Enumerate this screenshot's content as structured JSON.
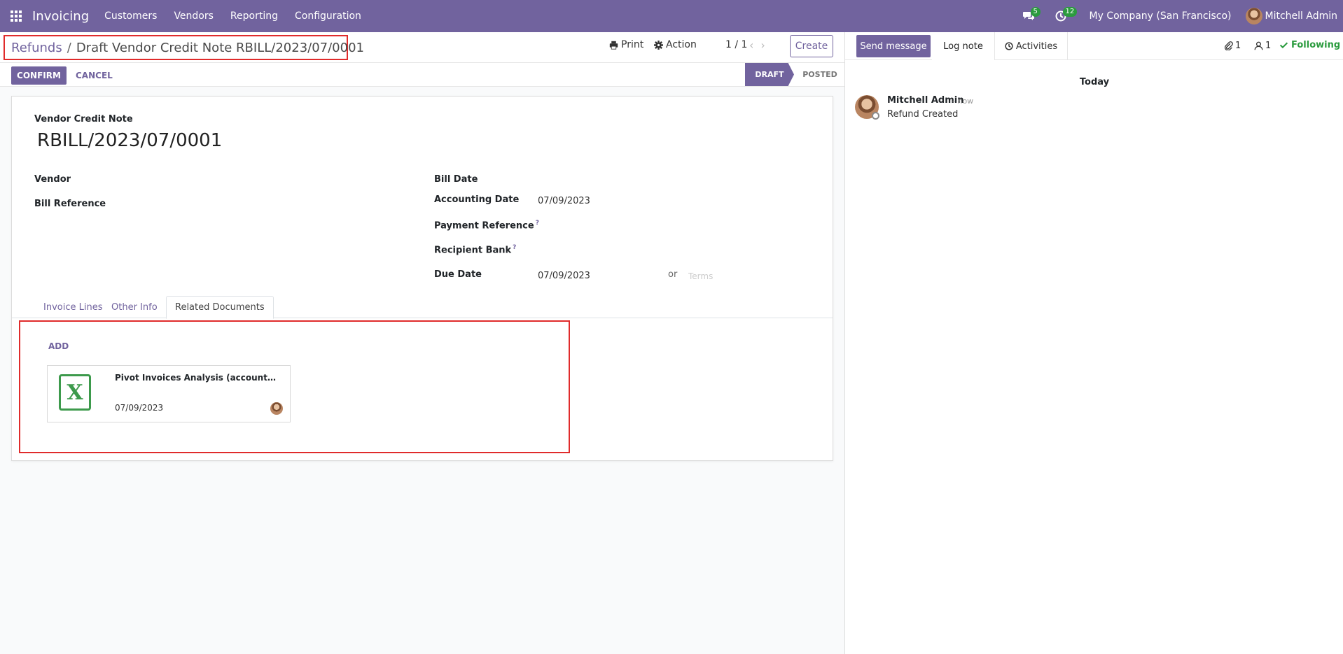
{
  "navbar": {
    "app_name": "Invoicing",
    "menu": [
      "Customers",
      "Vendors",
      "Reporting",
      "Configuration"
    ],
    "messages_count": "5",
    "activities_count": "12",
    "company": "My Company (San Francisco)",
    "user": "Mitchell Admin"
  },
  "control_panel": {
    "breadcrumb_parent": "Refunds",
    "breadcrumb_separator": "/",
    "breadcrumb_current": "Draft Vendor Credit Note RBILL/2023/07/0001",
    "print_label": "Print",
    "action_label": "Action",
    "pager": "1 / 1",
    "create_label": "Create"
  },
  "statusbar": {
    "confirm_label": "CONFIRM",
    "cancel_label": "CANCEL",
    "stages": [
      "DRAFT",
      "POSTED"
    ],
    "active_stage": "DRAFT"
  },
  "form": {
    "doc_type": "Vendor Credit Note",
    "doc_number": "RBILL/2023/07/0001",
    "labels": {
      "vendor": "Vendor",
      "bill_reference": "Bill Reference",
      "bill_date": "Bill Date",
      "accounting_date": "Accounting Date",
      "payment_reference": "Payment Reference",
      "recipient_bank": "Recipient Bank",
      "due_date": "Due Date"
    },
    "tooltip_marker": "?",
    "values": {
      "accounting_date": "07/09/2023",
      "due_date": "07/09/2023"
    },
    "or_label": "or",
    "terms_placeholder": "Terms"
  },
  "tabs": {
    "items": [
      "Invoice Lines",
      "Other Info",
      "Related Documents"
    ],
    "active": "Related Documents"
  },
  "related_documents": {
    "add_label": "ADD",
    "documents": [
      {
        "name": "Pivot Invoices Analysis (account.inv...",
        "date": "07/09/2023",
        "icon_letter": "X"
      }
    ]
  },
  "chatter": {
    "send_message_label": "Send message",
    "log_note_label": "Log note",
    "activities_label": "Activities",
    "attachments_count": "1",
    "followers_count": "1",
    "following_label": "Following",
    "day_label": "Today",
    "messages": [
      {
        "author": "Mitchell Admin",
        "time": "- now",
        "body": "Refund Created"
      }
    ]
  },
  "colors": {
    "brand": "#71639e",
    "badge": "#2b9b3e",
    "highlight_border": "#e02b2b",
    "excel_green": "#3d9a4c"
  }
}
